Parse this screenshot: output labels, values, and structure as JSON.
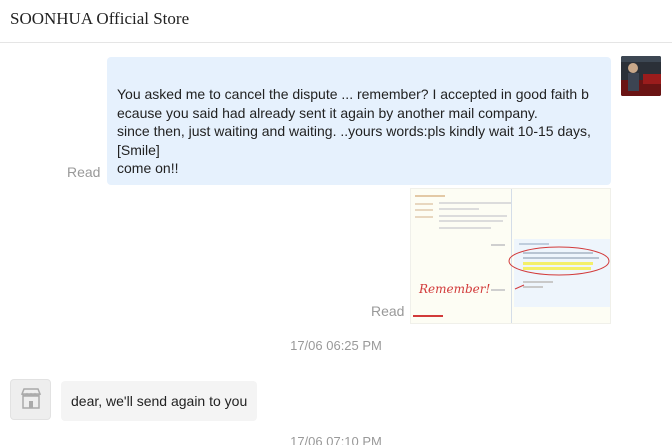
{
  "header": {
    "store_name": "SOONHUA Official Store"
  },
  "messages": [
    {
      "direction": "outgoing",
      "status": "Read",
      "lines": [
        "You asked me to cancel the dispute ... remember? I accepted in good faith b",
        "ecause you said  had already sent it again by another mail company.",
        "since then, just waiting and waiting. ..yours words:pls kindly wait 10-15 days,",
        " [Smile]",
        "come on!!"
      ]
    },
    {
      "direction": "outgoing",
      "status": "Read",
      "type": "image",
      "image_caption": "remember"
    },
    {
      "type": "timestamp",
      "text": "17/06 06:25 PM"
    },
    {
      "direction": "incoming",
      "text": "dear, we'll send  again  to you"
    },
    {
      "type": "timestamp",
      "text": "17/06 07:10 PM"
    }
  ],
  "icons": {
    "store_avatar": "store-icon",
    "user_avatar": "user-photo"
  },
  "colors": {
    "outgoing_bubble": "#e6f1fd",
    "incoming_bubble": "#f4f4f4",
    "meta_text": "#999999"
  }
}
